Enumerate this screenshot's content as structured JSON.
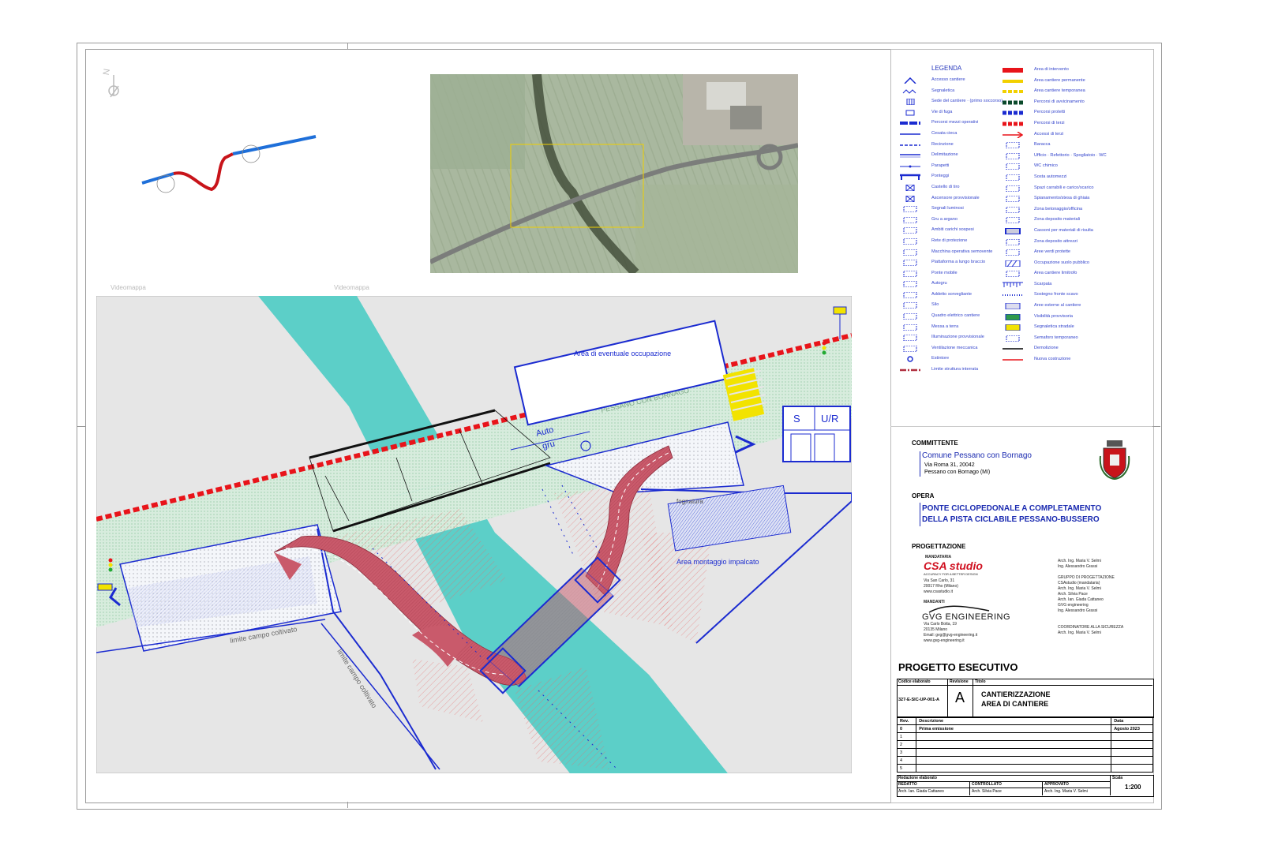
{
  "sheet": {
    "map_labels": [
      "Videomappa",
      "Videomappa"
    ],
    "north": "N"
  },
  "plan": {
    "area_eventuale": "Area di eventuale occupazione",
    "area_montaggio": "Area montaggio impalcato",
    "autogru_line1": "Auto",
    "autogru_line2": "gru",
    "fognatura": "fognatura",
    "limite_1": "limite campo coltivato",
    "limite_2": "limite campo coltivato",
    "road_name": "PESSANO CON BORNAGO",
    "box_s": "S",
    "box_ur": "U/R"
  },
  "legend": {
    "title": "LEGENDA",
    "left_items": [
      {
        "icon": "chevron-icon",
        "label": "Accesso cantiere"
      },
      {
        "icon": "zigzag-icon",
        "label": "Segnaletica"
      },
      {
        "icon": "grid-icon",
        "label": "Sede del cantiere\n(primo soccorso)"
      },
      {
        "icon": "rect-icon",
        "label": "Vie di fuga"
      },
      {
        "icon": "dash-bold-icon",
        "label": "Percorsi mezzi operativi"
      },
      {
        "icon": "line-icon",
        "label": "Cesata cieca"
      },
      {
        "icon": "dashed-line-icon",
        "label": "Recinzione"
      },
      {
        "icon": "double-line-icon",
        "label": "Delimitazione"
      },
      {
        "icon": "dot-line-icon",
        "label": "Parapetti"
      },
      {
        "icon": "bracket-icon",
        "label": "Ponteggi"
      },
      {
        "icon": "cross-box-icon",
        "label": "Castello di tiro"
      },
      {
        "icon": "cross-box-icon",
        "label": "Ascensore provvisionale"
      },
      {
        "icon": "light-icon",
        "label": "Segnali luminosi"
      },
      {
        "icon": "crane-icon",
        "label": "Gru a argano"
      },
      {
        "icon": "hatch-icon",
        "label": "Ambiti carichi sospesi"
      },
      {
        "icon": "net-icon",
        "label": "Rete di protezione"
      },
      {
        "icon": "machine-icon",
        "label": "Macchina operativa semovente"
      },
      {
        "icon": "platform-icon",
        "label": "Piattaforma a lungo braccio"
      },
      {
        "icon": "bridge-icon",
        "label": "Ponte mobile"
      },
      {
        "icon": "truck-icon",
        "label": "Autogru"
      },
      {
        "icon": "person-icon",
        "label": "Addetto sorvegliante"
      },
      {
        "icon": "silo-icon",
        "label": "Silo"
      },
      {
        "icon": "panel-icon",
        "label": "Quadro elettrico cantiere"
      },
      {
        "icon": "ground-icon",
        "label": "Messa a terra"
      },
      {
        "icon": "lamp-icon",
        "label": "Illuminazione provvisionale"
      },
      {
        "icon": "fan-icon",
        "label": "Ventilazione meccanica"
      },
      {
        "icon": "circle-icon",
        "label": "Estintore"
      },
      {
        "icon": "red-dash-dot-icon",
        "label": "Limite struttura interrata"
      }
    ],
    "right_items": [
      {
        "icon": "red-bar-icon",
        "label": "Area di intervento"
      },
      {
        "icon": "yellow-bar-icon",
        "label": "Area cantiere permanente"
      },
      {
        "icon": "yellow-dash-icon",
        "label": "Area cantiere temporanea"
      },
      {
        "icon": "green-dash-icon",
        "label": "Percorsi di avvicinamento"
      },
      {
        "icon": "blue-dash-icon",
        "label": "Percorsi protetti"
      },
      {
        "icon": "red-dash-icon",
        "label": "Percorsi di terzi"
      },
      {
        "icon": "red-arrow-icon",
        "label": "Accessi di terzi"
      },
      {
        "icon": "box-icon",
        "label": "Baracca"
      },
      {
        "icon": "ursw-icon",
        "label": "Ufficio\nRefettorio\nSpogliatoio\nWC"
      },
      {
        "icon": "wc-icon",
        "label": "WC chimico"
      },
      {
        "icon": "parking-icon",
        "label": "Sosta automezzi"
      },
      {
        "icon": "dash-rect-icon",
        "label": "Spazi carrabili e carico/scarico"
      },
      {
        "icon": "dot-rect-icon",
        "label": "Spianamento/stesa di ghiaia"
      },
      {
        "icon": "dot-rect-icon",
        "label": "Zona betonaggio/officina"
      },
      {
        "icon": "dot-rect-icon",
        "label": "Zona deposito materiali"
      },
      {
        "icon": "double-rect-icon",
        "label": "Cassoni per materiali di risulta"
      },
      {
        "icon": "dot-rect-icon",
        "label": "Zona deposito attrezzi"
      },
      {
        "icon": "dot-rect-icon",
        "label": "Aree verdi protette"
      },
      {
        "icon": "hatch-rect-icon",
        "label": "Occupazione suolo pubblico"
      },
      {
        "icon": "dot-rect-icon",
        "label": "Area cantiere limitrofo"
      },
      {
        "icon": "scarp-icon",
        "label": "Scarpata"
      },
      {
        "icon": "dotline-icon",
        "label": "Sostegno fronte scavo"
      },
      {
        "icon": "grey-rect-icon",
        "label": "Aree esterne al cantiere"
      },
      {
        "icon": "green-rect-icon",
        "label": "Visibilità provvisoria"
      },
      {
        "icon": "yellow-rect-icon",
        "label": "Segnaletica stradale"
      },
      {
        "icon": "semaphore-icon",
        "label": "Semaforo temporaneo"
      },
      {
        "icon": "black-line-icon",
        "label": "Demolizione"
      },
      {
        "icon": "red-line-icon",
        "label": "Nuova costruzione"
      }
    ]
  },
  "titleblock": {
    "committente_h": "COMMITTENTE",
    "committente": "Comune Pessano con Bornago",
    "addr1": "Via Roma 31, 20042",
    "addr2": "Pessano con Bornago (MI)",
    "opera_h": "OPERA",
    "opera1": "PONTE CICLOPEDONALE A COMPLETAMENTO",
    "opera2": "DELLA PISTA CICLABILE PESSANO-BUSSERO",
    "progettazione_h": "PROGETTAZIONE",
    "mandataria_h": "MANDATARIA",
    "csa_logo": "CSA studio",
    "csa_tag": "ACCURACY FOR A BETTER DESIGN",
    "csa_addr": [
      "Via San Carlo, 31",
      "20017 Rho (Milano)",
      "www.csastudio.it"
    ],
    "mandanti_h": "MANDANTI",
    "gvg_logo": "GVG ENGINEERING",
    "gvg_addr": [
      "Via Carlo Botta, 19",
      "20135 Milano",
      "Email: gvg@gvg-engineering.it",
      "www.gvg-engineering.it"
    ],
    "right_col": [
      "Arch. Ing. Maria V. Selmi",
      "Ing. Alessandro Grassi",
      "",
      "GRUPPO DI PROGETTAZIONE",
      "CSAstudio (mandataria)",
      "Arch. Ing. Maria V. Selmi",
      "Arch. Silvia Pace",
      "Arch. Ian. Giada Cattaneo",
      "GVG engineering",
      "Ing. Alessandro Grassi",
      "",
      "",
      "COORDINATORE ALLA SICUREZZA",
      "Arch. Ing. Maria V. Selmi"
    ],
    "progetto": "PROGETTO ESECUTIVO",
    "codice_h": "Codice elaborato",
    "codice": "327-E-SIC-UP-001-A",
    "revisione_h": "Revisione",
    "revisione": "A",
    "titolo_h": "Titolo",
    "titolo1": "CANTIERIZZAZIONE",
    "titolo2": "AREA DI CANTIERE",
    "rev_header": [
      "Rev.",
      "Descrizione",
      "Data"
    ],
    "rev_rows": [
      [
        "0",
        "Prima emissione",
        "Agosto 2023"
      ],
      [
        "1",
        "",
        ""
      ],
      [
        "2",
        "",
        ""
      ],
      [
        "3",
        "",
        ""
      ],
      [
        "4",
        "",
        ""
      ],
      [
        "5",
        "",
        ""
      ]
    ],
    "redazione_h": "Redazione elaborato",
    "scala_h": "Scala",
    "redatto_h": "REDATTO",
    "controllato_h": "CONTROLLATO",
    "approvato_h": "APPROVATO",
    "redatto": "Arch. Ian. Giada Cattaneo",
    "controllato": "Arch. Silvia Pace",
    "approvato": "Arch. Ing. Maria V. Selmi",
    "scala": "1:200"
  },
  "colors": {
    "blue": "#1b2bd0",
    "red": "#e8141a",
    "river": "#5ccfc8",
    "road": "#cfe6d4",
    "path": "#c95a6b",
    "ground": "#e6e6e6"
  }
}
